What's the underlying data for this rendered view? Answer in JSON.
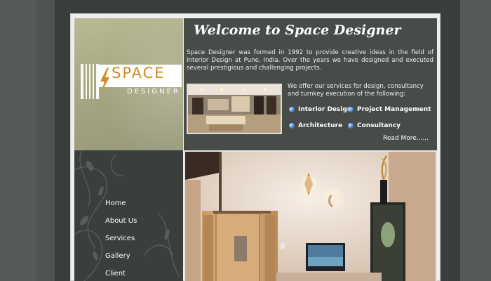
{
  "intro": {
    "title": "Welcome to Space Designer",
    "paragraph": "Space Designer was formed in 1992 to provide creative ideas in the field of Interior Design at Pune, India. Over the years we have designed and executed several prestigious and challenging projects.",
    "offer": "We offer our services for design, consultancy and turnkey execution of the following:",
    "services": [
      "Interior Design",
      "Project Management",
      "Architecture",
      "Consultancy"
    ],
    "read_more": "Read More......"
  },
  "logo": {
    "word1": "SPACE",
    "word2": "DESIGNER",
    "accent_color": "#d08b22"
  },
  "nav": [
    "Home",
    "About Us",
    "Services",
    "Gallery",
    "Client"
  ],
  "colors": {
    "page_bg": "#545a55",
    "panel_dark": "#474c48",
    "logo_panel": "#a6a882",
    "bullet": "#3e7fd0"
  }
}
